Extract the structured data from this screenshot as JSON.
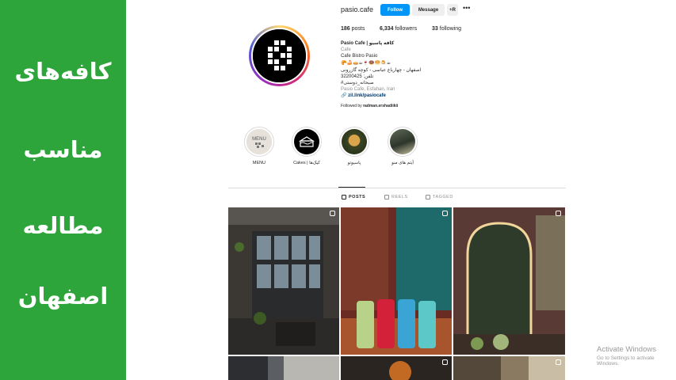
{
  "banner": {
    "lines": [
      "کافه‌های",
      "مناسب",
      "مطالعه",
      "اصفهان"
    ],
    "background": "#2ea53b"
  },
  "profile": {
    "username": "pasio.cafe",
    "follow_label": "Follow",
    "message_label": "Message",
    "suggest_label": "+R",
    "more_label": "•••",
    "stats": {
      "posts": "186",
      "posts_label": "posts",
      "followers": "6,334",
      "followers_label": "followers",
      "following": "33",
      "following_label": "following"
    },
    "bio": {
      "name": "Pasio Cafe | کافه پاسیو",
      "category": "Cafe",
      "description": "Cafe Bistro Pasio",
      "emoji_line": "🥐🍰🥧☕🍷🍩🥯🍮☕",
      "address": "اصفهان - چهارباغ عباسی - کوچه گازرونی",
      "phone": "تلفن: 32200425",
      "hashtag": "صبحانه_دوستی#",
      "location": "Pasio Cafe, Esfahan, Iran",
      "link": "zil.link/pasiocafe",
      "followed_by_prefix": "Followed by",
      "followed_by_user": "radman.ershadiikii"
    }
  },
  "highlights": [
    {
      "label": "MENU"
    },
    {
      "label": "Cakes | کیک‌ها"
    },
    {
      "label": "پاسیوتو"
    },
    {
      "label": "آیتم های منو"
    }
  ],
  "tabs": [
    {
      "label": "POSTS",
      "active": true
    },
    {
      "label": "REELS",
      "active": false
    },
    {
      "label": "TAGGED",
      "active": false
    }
  ],
  "posts": [
    {
      "type": "reel"
    },
    {
      "type": "reel"
    },
    {
      "type": "reel"
    },
    {
      "type": "image"
    },
    {
      "type": "reel"
    },
    {
      "type": "reel"
    }
  ],
  "watermark": {
    "title": "Activate Windows",
    "subtitle": "Go to Settings to activate Windows."
  }
}
